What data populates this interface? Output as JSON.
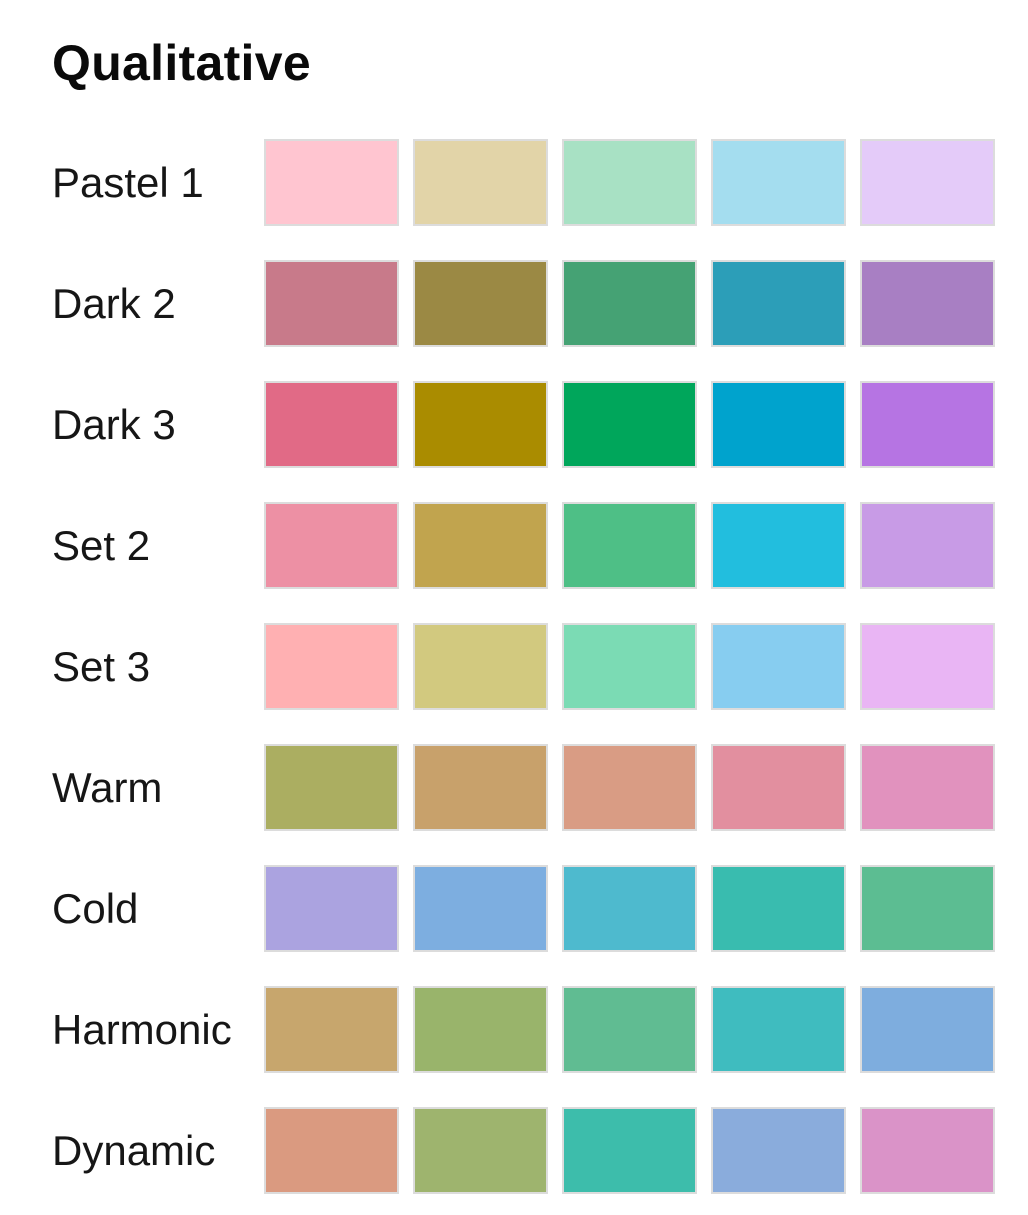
{
  "title": "Qualitative",
  "palettes": [
    {
      "name": "Pastel 1",
      "colors": [
        "#FFC5D0",
        "#E2D4A8",
        "#A8E1C4",
        "#A4DDEF",
        "#E4CBF9"
      ]
    },
    {
      "name": "Dark 2",
      "colors": [
        "#C87A8A",
        "#9B8944",
        "#45A274",
        "#2C9EB8",
        "#A87FC3"
      ]
    },
    {
      "name": "Dark 3",
      "colors": [
        "#E16A86",
        "#AA8C00",
        "#00A65B",
        "#00A3CD",
        "#B674E3"
      ]
    },
    {
      "name": "Set 2",
      "colors": [
        "#ED90A4",
        "#C1A44E",
        "#4EBF86",
        "#22BEDE",
        "#C89BE6"
      ]
    },
    {
      "name": "Set 3",
      "colors": [
        "#FFB0B2",
        "#D2C97F",
        "#7BDBB4",
        "#87CDF0",
        "#E9B5F4"
      ]
    },
    {
      "name": "Warm",
      "colors": [
        "#ABAE61",
        "#C8A16B",
        "#D99C84",
        "#E28F9F",
        "#E192BE"
      ]
    },
    {
      "name": "Cold",
      "colors": [
        "#ABA3E0",
        "#7DAEE0",
        "#4EBACE",
        "#39BCAF",
        "#5CBD92"
      ]
    },
    {
      "name": "Harmonic",
      "colors": [
        "#C7A66D",
        "#99B46B",
        "#60BC92",
        "#3FBCBF",
        "#7EADDE"
      ]
    },
    {
      "name": "Dynamic",
      "colors": [
        "#DA9A80",
        "#9EB46E",
        "#3DBDAB",
        "#8AACDC",
        "#DA93C8"
      ]
    }
  ]
}
